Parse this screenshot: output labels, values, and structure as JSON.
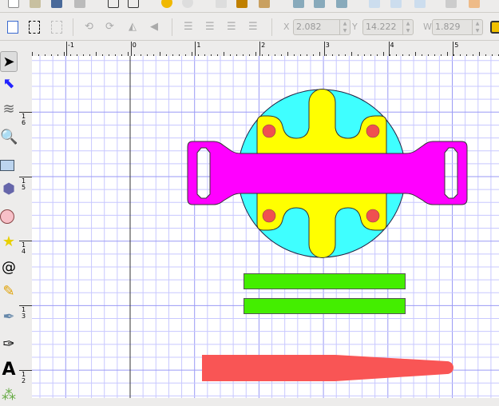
{
  "controls": {
    "x_label": "X",
    "x_value": "2.082",
    "y_label": "Y",
    "y_value": "14.222",
    "w_label": "W",
    "w_value": "1.829"
  },
  "hruler": {
    "ticks": [
      "-1",
      "0",
      "1",
      "2",
      "3",
      "4",
      "5"
    ]
  },
  "vruler": {
    "ticks": [
      "16",
      "15",
      "14",
      "13",
      "12"
    ]
  },
  "tools": [
    "selector",
    "node-editor",
    "tweak",
    "zoom",
    "rectangle",
    "3d-box",
    "ellipse",
    "star",
    "spiral",
    "pencil",
    "pen",
    "calligraphy",
    "text",
    "spray"
  ],
  "colors": {
    "circle": "#3fffff",
    "cross": "#ffff00",
    "strap": "#ff00ff",
    "dots": "#f05050",
    "bars": "#44ee00",
    "blade": "#f95555",
    "grid": "#c8c8ff",
    "grid_major": "#9a9af5"
  }
}
